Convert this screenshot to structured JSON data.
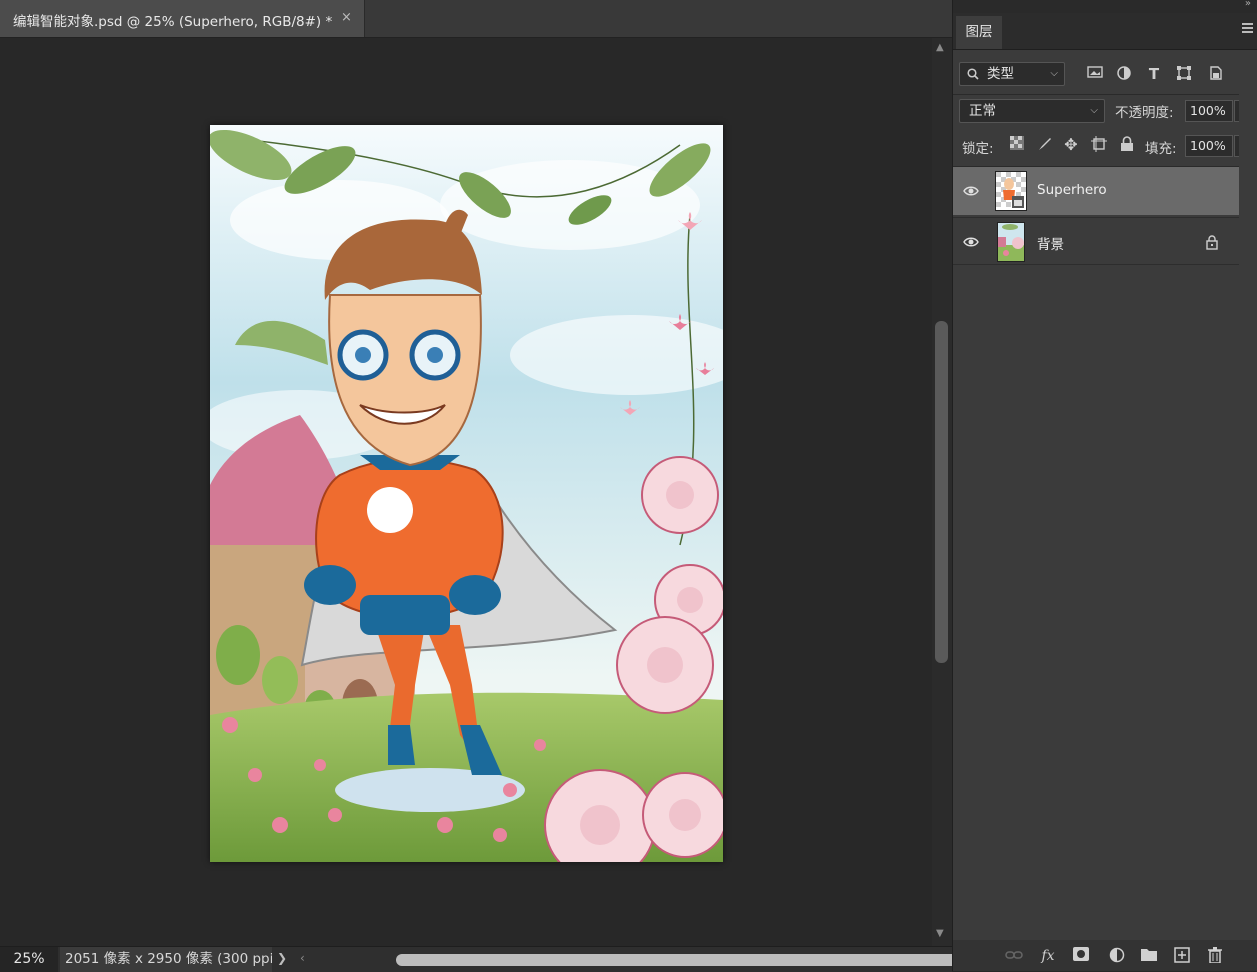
{
  "document": {
    "tab_title": "编辑智能对象.psd @ 25% (Superhero, RGB/8#) *",
    "close_glyph": "×"
  },
  "status": {
    "zoom": "25%",
    "doc_info": "2051 像素 x 2950 像素 (300 ppi)",
    "info_arrow": "❯",
    "scroll_left": "‹"
  },
  "panel": {
    "tab_label": "图层",
    "filter": {
      "label": "类型",
      "icon": "search-icon"
    },
    "filter_icons": [
      "image-filter-icon",
      "adjustment-filter-icon",
      "type-filter-icon",
      "shape-filter-icon",
      "smart-object-filter-icon"
    ],
    "blend_mode": "正常",
    "opacity_label": "不透明度:",
    "opacity_value": "100%",
    "lock_label": "锁定:",
    "lock_icons": [
      "lock-transparent-icon",
      "lock-image-icon",
      "lock-position-icon",
      "lock-artboard-icon",
      "lock-all-icon"
    ],
    "fill_label": "填充:",
    "fill_value": "100%",
    "layers": [
      {
        "name": "Superhero",
        "selected": true,
        "visible": true,
        "locked": false,
        "type": "smart-object"
      },
      {
        "name": "背景",
        "selected": false,
        "visible": true,
        "locked": true,
        "type": "background"
      }
    ],
    "footer_icons": [
      "link-layers-icon",
      "fx-icon",
      "add-mask-icon",
      "new-adjustment-icon",
      "new-group-icon",
      "new-layer-icon",
      "delete-layer-icon"
    ],
    "fx_label": "fx"
  },
  "colors": {
    "selected_layer": "#6a6a6a",
    "panel_bg": "#3b3b3b",
    "canvas_bg": "#282828"
  }
}
